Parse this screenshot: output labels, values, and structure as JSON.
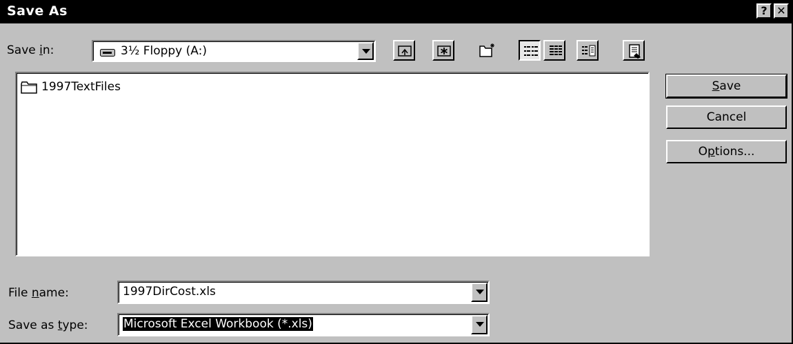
{
  "window": {
    "title": "Save As",
    "help_label": "?",
    "close_label": "✕"
  },
  "save_in": {
    "label_pre": "Save ",
    "label_accel": "i",
    "label_post": "n:",
    "drive_icon": "floppy-drive-icon",
    "value": "3½ Floppy (A:)"
  },
  "toolbar": [
    {
      "name": "up-one-level",
      "icon": "up-folder-icon"
    },
    {
      "name": "look-in-favorites",
      "icon": "favorites-icon"
    },
    {
      "name": "create-new-folder",
      "icon": "new-folder-icon"
    },
    {
      "name": "list-view",
      "icon": "list-view-icon",
      "pressed": true
    },
    {
      "name": "details-view",
      "icon": "details-view-icon"
    },
    {
      "name": "properties-view",
      "icon": "properties-view-icon"
    },
    {
      "name": "commands-settings",
      "icon": "commands-icon"
    }
  ],
  "files": [
    {
      "name": "1997TextFiles",
      "icon": "folder-icon"
    }
  ],
  "buttons": {
    "save": {
      "accel": "S",
      "rest": "ave"
    },
    "cancel": {
      "label": "Cancel"
    },
    "options": {
      "pre": "O",
      "accel": "p",
      "post": "tions..."
    }
  },
  "file_name": {
    "label_pre": "File ",
    "label_accel": "n",
    "label_post": "ame:",
    "value": "1997DirCost.xls"
  },
  "save_as_type": {
    "label_pre": "Save as ",
    "label_accel": "t",
    "label_post": "ype:",
    "value": "Microsoft Excel Workbook (*.xls)"
  },
  "colors": {
    "face": "#c0c0c0",
    "titlebar": "#000000",
    "highlight": "#000000"
  }
}
